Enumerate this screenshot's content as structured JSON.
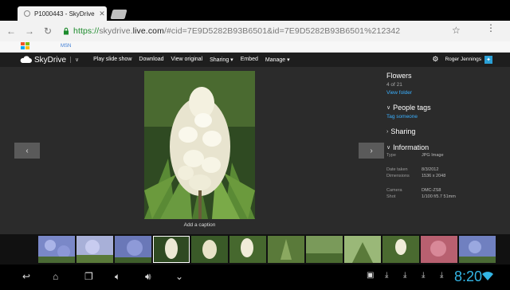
{
  "browser": {
    "tab_title": "P1000443 - SkyDrive",
    "url_scheme": "https://",
    "url_sub": "skydrive.",
    "url_domain": "live.com",
    "url_rest": "/#cid=7E9D5282B93B6501&id=7E9D5282B93B6501%212342",
    "bookmark_label": "MSN"
  },
  "skydrive": {
    "brand": "SkyDrive",
    "commands": [
      "Play slide show",
      "Download",
      "View original",
      "Sharing ▾",
      "Embed",
      "Manage ▾"
    ],
    "user_name": "Roger Jennings"
  },
  "viewer": {
    "caption": "Add a caption",
    "prev_icon": "chevron-left-icon",
    "next_icon": "chevron-right-icon"
  },
  "sidebar": {
    "folder": "Flowers",
    "position": "4 of 21",
    "view_folder": "View folder",
    "people_tags": "People tags",
    "tag_someone": "Tag someone",
    "sharing": "Sharing",
    "information": "Information",
    "info": {
      "type_label": "Type",
      "type_value": "JPG Image",
      "date_label": "Date taken",
      "date_value": "8/3/2012",
      "dims_label": "Dimensions",
      "dims_value": "1536 x 2048",
      "camera_label": "Camera",
      "camera_value": "DMC-ZS8",
      "shot_label": "Shot",
      "shot_value": "1/100 f/5.7 51mm"
    }
  },
  "system": {
    "clock": "8:20"
  },
  "colors": {
    "accent": "#33b5e5",
    "link": "#3ab0ff",
    "secure_url": "#1c8b2c"
  }
}
